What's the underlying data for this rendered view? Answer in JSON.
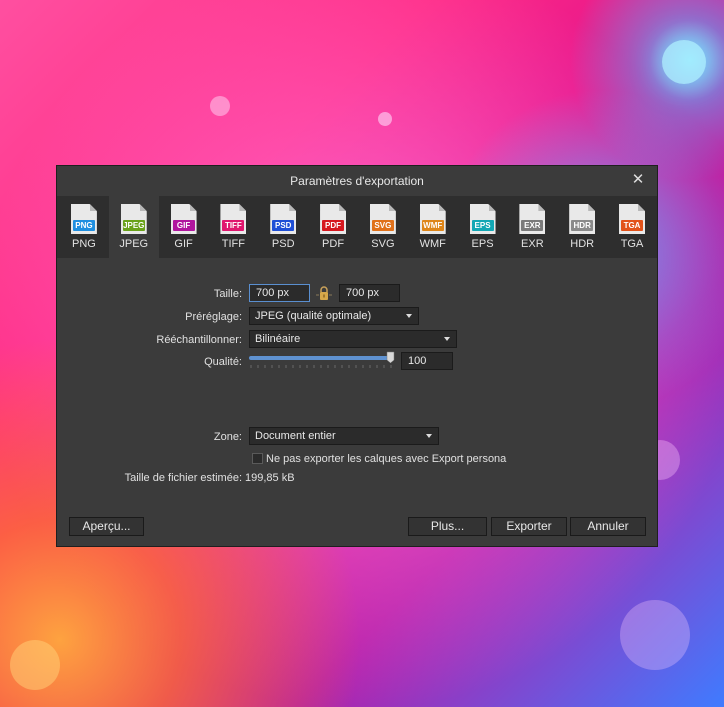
{
  "dialog": {
    "title": "Paramètres d'exportation",
    "close_glyph": "✕"
  },
  "formats": [
    {
      "name": "PNG",
      "badge": "PNG",
      "color": "#1f8fe0"
    },
    {
      "name": "JPEG",
      "badge": "JPEG",
      "color": "#6aa21a"
    },
    {
      "name": "GIF",
      "badge": "GIF",
      "color": "#b0169e"
    },
    {
      "name": "TIFF",
      "badge": "TIFF",
      "color": "#e0166e"
    },
    {
      "name": "PSD",
      "badge": "PSD",
      "color": "#1f4fd6"
    },
    {
      "name": "PDF",
      "badge": "PDF",
      "color": "#d6181f"
    },
    {
      "name": "SVG",
      "badge": "SVG",
      "color": "#e0711a"
    },
    {
      "name": "WMF",
      "badge": "WMF",
      "color": "#de8619"
    },
    {
      "name": "EPS",
      "badge": "EPS",
      "color": "#12a7b4"
    },
    {
      "name": "EXR",
      "badge": "EXR",
      "color": "#7a7a7a"
    },
    {
      "name": "HDR",
      "badge": "HDR",
      "color": "#8a8a8a"
    },
    {
      "name": "TGA",
      "badge": "TGA",
      "color": "#e25219"
    }
  ],
  "active_format": "JPEG",
  "settings": {
    "size_label": "Taille:",
    "width_value": "700 px",
    "height_value": "700 px",
    "preset_label": "Préréglage:",
    "preset_value": "JPEG (qualité optimale)",
    "resample_label": "Rééchantillonner:",
    "resample_value": "Bilinéaire",
    "quality_label": "Qualité:",
    "quality_value": "100",
    "quality_level": 1.0,
    "zone_label": "Zone:",
    "zone_value": "Document entier",
    "checkbox_label": "Ne pas exporter les calques avec Export persona",
    "checkbox_checked": false,
    "filesize_label": "Taille de fichier estimée:",
    "filesize_value": "199,85 kB"
  },
  "buttons": {
    "preview": "Aperçu...",
    "more": "Plus...",
    "export": "Exporter",
    "cancel": "Annuler"
  }
}
